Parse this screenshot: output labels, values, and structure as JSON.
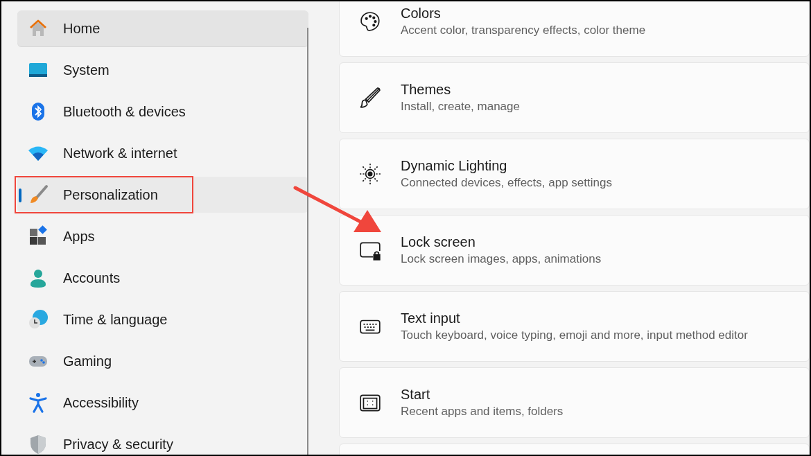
{
  "sidebar": {
    "items": [
      {
        "label": "Home",
        "selected": false,
        "hovered": true,
        "highlighted": false
      },
      {
        "label": "System",
        "selected": false,
        "hovered": false,
        "highlighted": false
      },
      {
        "label": "Bluetooth & devices",
        "selected": false,
        "hovered": false,
        "highlighted": false
      },
      {
        "label": "Network & internet",
        "selected": false,
        "hovered": false,
        "highlighted": false
      },
      {
        "label": "Personalization",
        "selected": true,
        "hovered": false,
        "highlighted": true
      },
      {
        "label": "Apps",
        "selected": false,
        "hovered": false,
        "highlighted": false
      },
      {
        "label": "Accounts",
        "selected": false,
        "hovered": false,
        "highlighted": false
      },
      {
        "label": "Time & language",
        "selected": false,
        "hovered": false,
        "highlighted": false
      },
      {
        "label": "Gaming",
        "selected": false,
        "hovered": false,
        "highlighted": false
      },
      {
        "label": "Accessibility",
        "selected": false,
        "hovered": false,
        "highlighted": false
      },
      {
        "label": "Privacy & security",
        "selected": false,
        "hovered": false,
        "highlighted": false
      }
    ]
  },
  "settings": [
    {
      "title": "Colors",
      "description": "Accent color, transparency effects, color theme"
    },
    {
      "title": "Themes",
      "description": "Install, create, manage"
    },
    {
      "title": "Dynamic Lighting",
      "description": "Connected devices, effects, app settings"
    },
    {
      "title": "Lock screen",
      "description": "Lock screen images, apps, animations"
    },
    {
      "title": "Text input",
      "description": "Touch keyboard, voice typing, emoji and more, input method editor"
    },
    {
      "title": "Start",
      "description": "Recent apps and items, folders"
    }
  ]
}
